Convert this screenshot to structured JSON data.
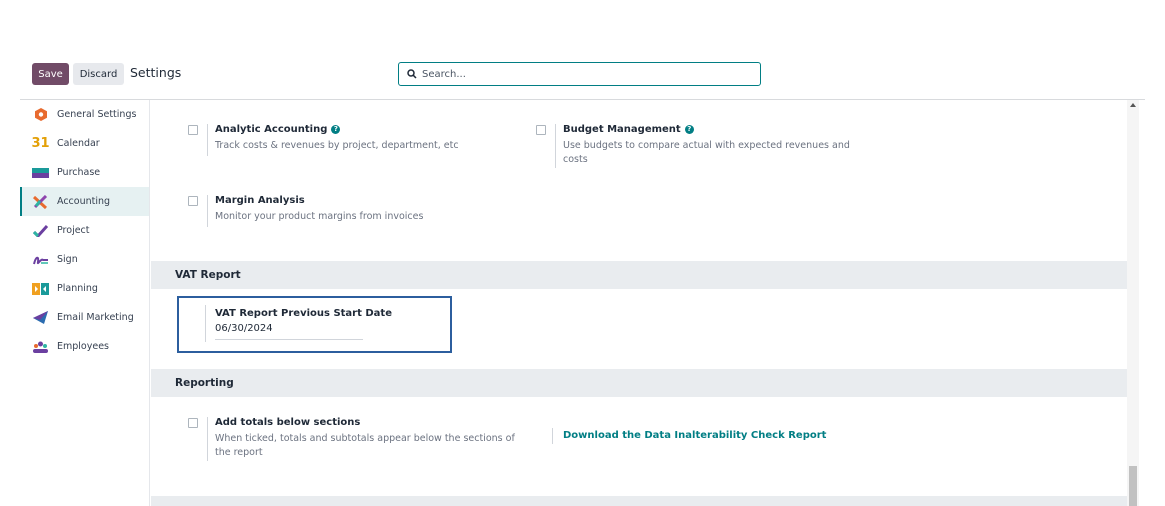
{
  "toolbar": {
    "save_label": "Save",
    "discard_label": "Discard",
    "title": "Settings"
  },
  "search": {
    "placeholder": "Search..."
  },
  "sidebar": {
    "items": [
      {
        "label": "General Settings",
        "icon": "odoo-icon"
      },
      {
        "label": "Calendar",
        "icon": "calendar-icon"
      },
      {
        "label": "Purchase",
        "icon": "purchase-icon"
      },
      {
        "label": "Accounting",
        "icon": "accounting-icon",
        "active": true
      },
      {
        "label": "Project",
        "icon": "project-icon"
      },
      {
        "label": "Sign",
        "icon": "sign-icon"
      },
      {
        "label": "Planning",
        "icon": "planning-icon"
      },
      {
        "label": "Email Marketing",
        "icon": "email-marketing-icon"
      },
      {
        "label": "Employees",
        "icon": "employees-icon"
      }
    ],
    "calendar_day": "31"
  },
  "settings": {
    "analytic": {
      "label": "Analytic Accounting",
      "desc": "Track costs & revenues by project, department, etc"
    },
    "budget": {
      "label": "Budget Management",
      "desc": "Use budgets to compare actual with expected revenues and costs"
    },
    "margin": {
      "label": "Margin Analysis",
      "desc": "Monitor your product margins from invoices"
    }
  },
  "vat_section": {
    "header": "VAT Report",
    "field_label": "VAT Report Previous Start Date",
    "field_value": "06/30/2024"
  },
  "reporting_section": {
    "header": "Reporting",
    "totals_label": "Add totals below sections",
    "totals_desc": "When ticked, totals and subtotals appear below the sections of the report",
    "download_link": "Download the Data Inalterability Check Report"
  },
  "colors": {
    "brand": "#714b67",
    "accent": "#017e84",
    "highlight_box": "#2c5e9e"
  }
}
